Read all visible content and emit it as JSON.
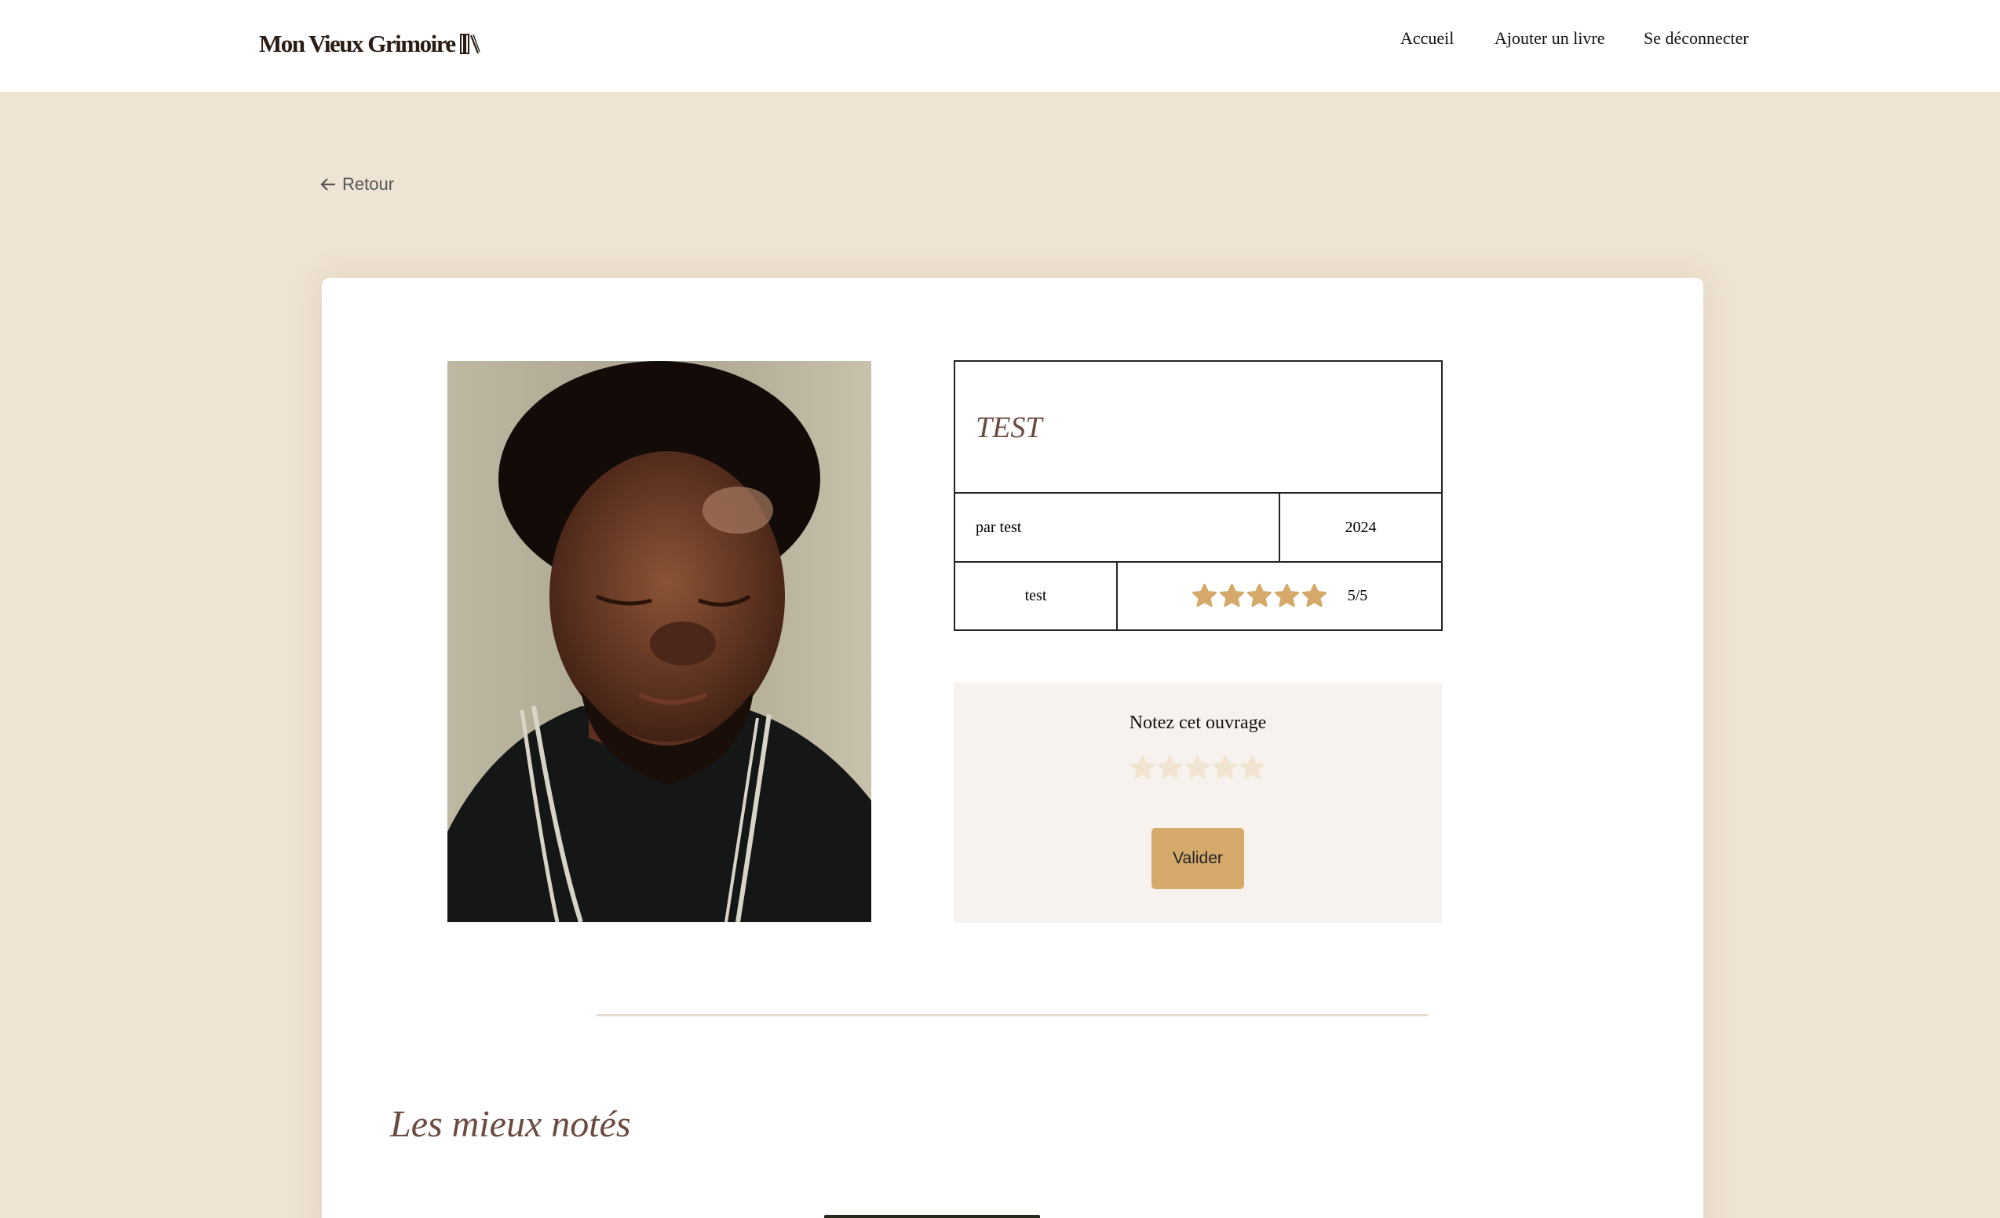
{
  "header": {
    "logo_text": "Mon Vieux Grimoire",
    "nav": [
      "Accueil",
      "Ajouter un livre",
      "Se déconnecter"
    ]
  },
  "back": {
    "label": "Retour"
  },
  "book": {
    "title": "TEST",
    "author": "par test",
    "year": "2024",
    "genre": "test",
    "rating_value": 5,
    "rating_text": "5/5"
  },
  "rate": {
    "label": "Notez cet ouvrage",
    "selected_stars": 0,
    "submit_label": "Valider"
  },
  "best_rated": {
    "title": "Les mieux notés"
  },
  "colors": {
    "background": "#efe3d3",
    "accent": "#d4a96a",
    "title": "#6b4a3f",
    "empty_star": "#f1e4d0"
  }
}
